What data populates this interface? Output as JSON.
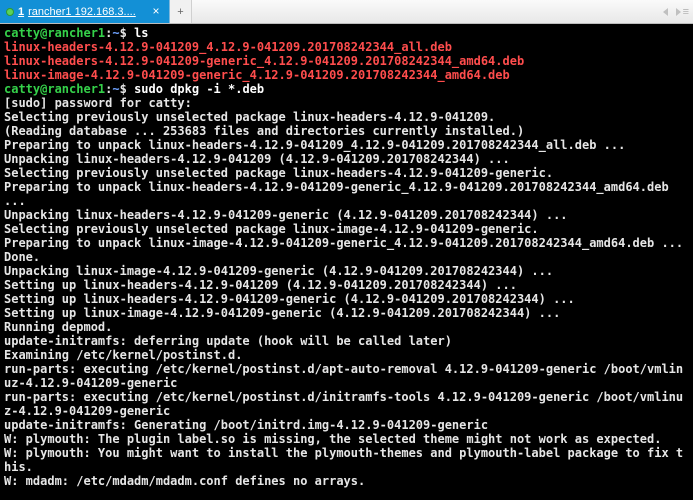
{
  "tabbar": {
    "tab1": {
      "number": "1",
      "label": "rancher1 192.168.3....",
      "close": "×",
      "addLabel": "+"
    },
    "menu": "≡"
  },
  "prompt": {
    "userhost": "catty@rancher1",
    "sep": ":",
    "path": "~",
    "sigil": "$ "
  },
  "cmd1": "ls",
  "ls": {
    "l1": "linux-headers-4.12.9-041209_4.12.9-041209.201708242344_all.deb",
    "l2": "linux-headers-4.12.9-041209-generic_4.12.9-041209.201708242344_amd64.deb",
    "l3": "linux-image-4.12.9-041209-generic_4.12.9-041209.201708242344_amd64.deb"
  },
  "cmd2": "sudo dpkg -i *.deb",
  "out": {
    "o01": "[sudo] password for catty:",
    "o02": "Selecting previously unselected package linux-headers-4.12.9-041209.",
    "o03": "(Reading database ... 253683 files and directories currently installed.)",
    "o04": "Preparing to unpack linux-headers-4.12.9-041209_4.12.9-041209.201708242344_all.deb ...",
    "o05": "Unpacking linux-headers-4.12.9-041209 (4.12.9-041209.201708242344) ...",
    "o06": "Selecting previously unselected package linux-headers-4.12.9-041209-generic.",
    "o07": "Preparing to unpack linux-headers-4.12.9-041209-generic_4.12.9-041209.201708242344_amd64.deb ...",
    "o08": "Unpacking linux-headers-4.12.9-041209-generic (4.12.9-041209.201708242344) ...",
    "o09": "Selecting previously unselected package linux-image-4.12.9-041209-generic.",
    "o10": "Preparing to unpack linux-image-4.12.9-041209-generic_4.12.9-041209.201708242344_amd64.deb ...",
    "o11": "Done.",
    "o12": "Unpacking linux-image-4.12.9-041209-generic (4.12.9-041209.201708242344) ...",
    "o13": "Setting up linux-headers-4.12.9-041209 (4.12.9-041209.201708242344) ...",
    "o14": "Setting up linux-headers-4.12.9-041209-generic (4.12.9-041209.201708242344) ...",
    "o15": "Setting up linux-image-4.12.9-041209-generic (4.12.9-041209.201708242344) ...",
    "o16": "Running depmod.",
    "o17": "update-initramfs: deferring update (hook will be called later)",
    "o18": "Examining /etc/kernel/postinst.d.",
    "o19": "run-parts: executing /etc/kernel/postinst.d/apt-auto-removal 4.12.9-041209-generic /boot/vmlinuz-4.12.9-041209-generic",
    "o20": "run-parts: executing /etc/kernel/postinst.d/initramfs-tools 4.12.9-041209-generic /boot/vmlinuz-4.12.9-041209-generic",
    "o21": "update-initramfs: Generating /boot/initrd.img-4.12.9-041209-generic",
    "o22": "W: plymouth: The plugin label.so is missing, the selected theme might not work as expected.",
    "o23": "W: plymouth: You might want to install the plymouth-themes and plymouth-label package to fix this.",
    "o24": "W: mdadm: /etc/mdadm/mdadm.conf defines no arrays."
  }
}
